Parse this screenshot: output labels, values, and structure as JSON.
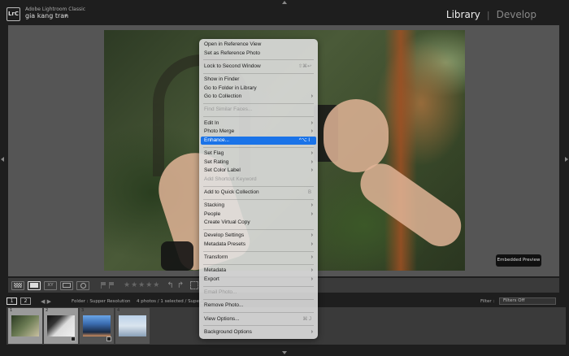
{
  "header": {
    "logo": "LrC",
    "app_name": "Adobe Lightroom Classic",
    "user_name": "gia kang tran",
    "modules": [
      "Library",
      "Develop"
    ],
    "active_module": "Library"
  },
  "view": {
    "embedded_preview": "Embedded Preview"
  },
  "toolbar": {
    "compare_label": "XY",
    "stars": "★★★★★"
  },
  "filmstrip_header": {
    "monitor_1": "1",
    "monitor_2": "2",
    "folder": "Folder : Supper Resolution",
    "count": "4 photos / 1 selected / Super_",
    "filter_label": "Filter :",
    "filter_value": "Filters Off"
  },
  "filmstrip": {
    "thumbs": [
      {
        "num": "1",
        "selected": true
      },
      {
        "num": "2",
        "selected": true
      },
      {
        "num": "3",
        "selected": false
      },
      {
        "num": "4",
        "selected": false
      }
    ]
  },
  "menu": {
    "items": [
      {
        "label": "Open in Reference View"
      },
      {
        "label": "Set as Reference Photo"
      },
      {
        "sep": true
      },
      {
        "label": "Lock to Second Window",
        "shortcut": "⇧⌘↩"
      },
      {
        "sep": true
      },
      {
        "label": "Show in Finder"
      },
      {
        "label": "Go to Folder in Library"
      },
      {
        "label": "Go to Collection",
        "submenu": true
      },
      {
        "sep": true
      },
      {
        "label": "Find Similar Faces...",
        "disabled": true
      },
      {
        "sep": true
      },
      {
        "label": "Edit In",
        "submenu": true
      },
      {
        "label": "Photo Merge",
        "submenu": true
      },
      {
        "label": "Enhance...",
        "shortcut": "^⌥ I",
        "highlight": true
      },
      {
        "sep": true
      },
      {
        "label": "Set Flag",
        "submenu": true
      },
      {
        "label": "Set Rating",
        "submenu": true
      },
      {
        "label": "Set Color Label",
        "submenu": true
      },
      {
        "label": "Add Shortcut Keyword",
        "disabled": true
      },
      {
        "sep": true
      },
      {
        "label": "Add to Quick Collection",
        "shortcut": "B"
      },
      {
        "sep": true
      },
      {
        "label": "Stacking",
        "submenu": true
      },
      {
        "label": "People",
        "submenu": true
      },
      {
        "label": "Create Virtual Copy"
      },
      {
        "sep": true
      },
      {
        "label": "Develop Settings",
        "submenu": true
      },
      {
        "label": "Metadata Presets",
        "submenu": true
      },
      {
        "sep": true
      },
      {
        "label": "Transform",
        "submenu": true
      },
      {
        "sep": true
      },
      {
        "label": "Metadata",
        "submenu": true
      },
      {
        "label": "Export",
        "submenu": true
      },
      {
        "sep": true
      },
      {
        "label": "Email Photo...",
        "disabled": true
      },
      {
        "sep": true
      },
      {
        "label": "Remove Photo..."
      },
      {
        "sep": true
      },
      {
        "label": "View Options...",
        "shortcut": "⌘ J"
      },
      {
        "sep": true
      },
      {
        "label": "Background Options",
        "submenu": true
      }
    ]
  },
  "colors": {
    "highlight": "#1a73e8",
    "background": "#1e1e1e",
    "center_bg": "#555555"
  }
}
